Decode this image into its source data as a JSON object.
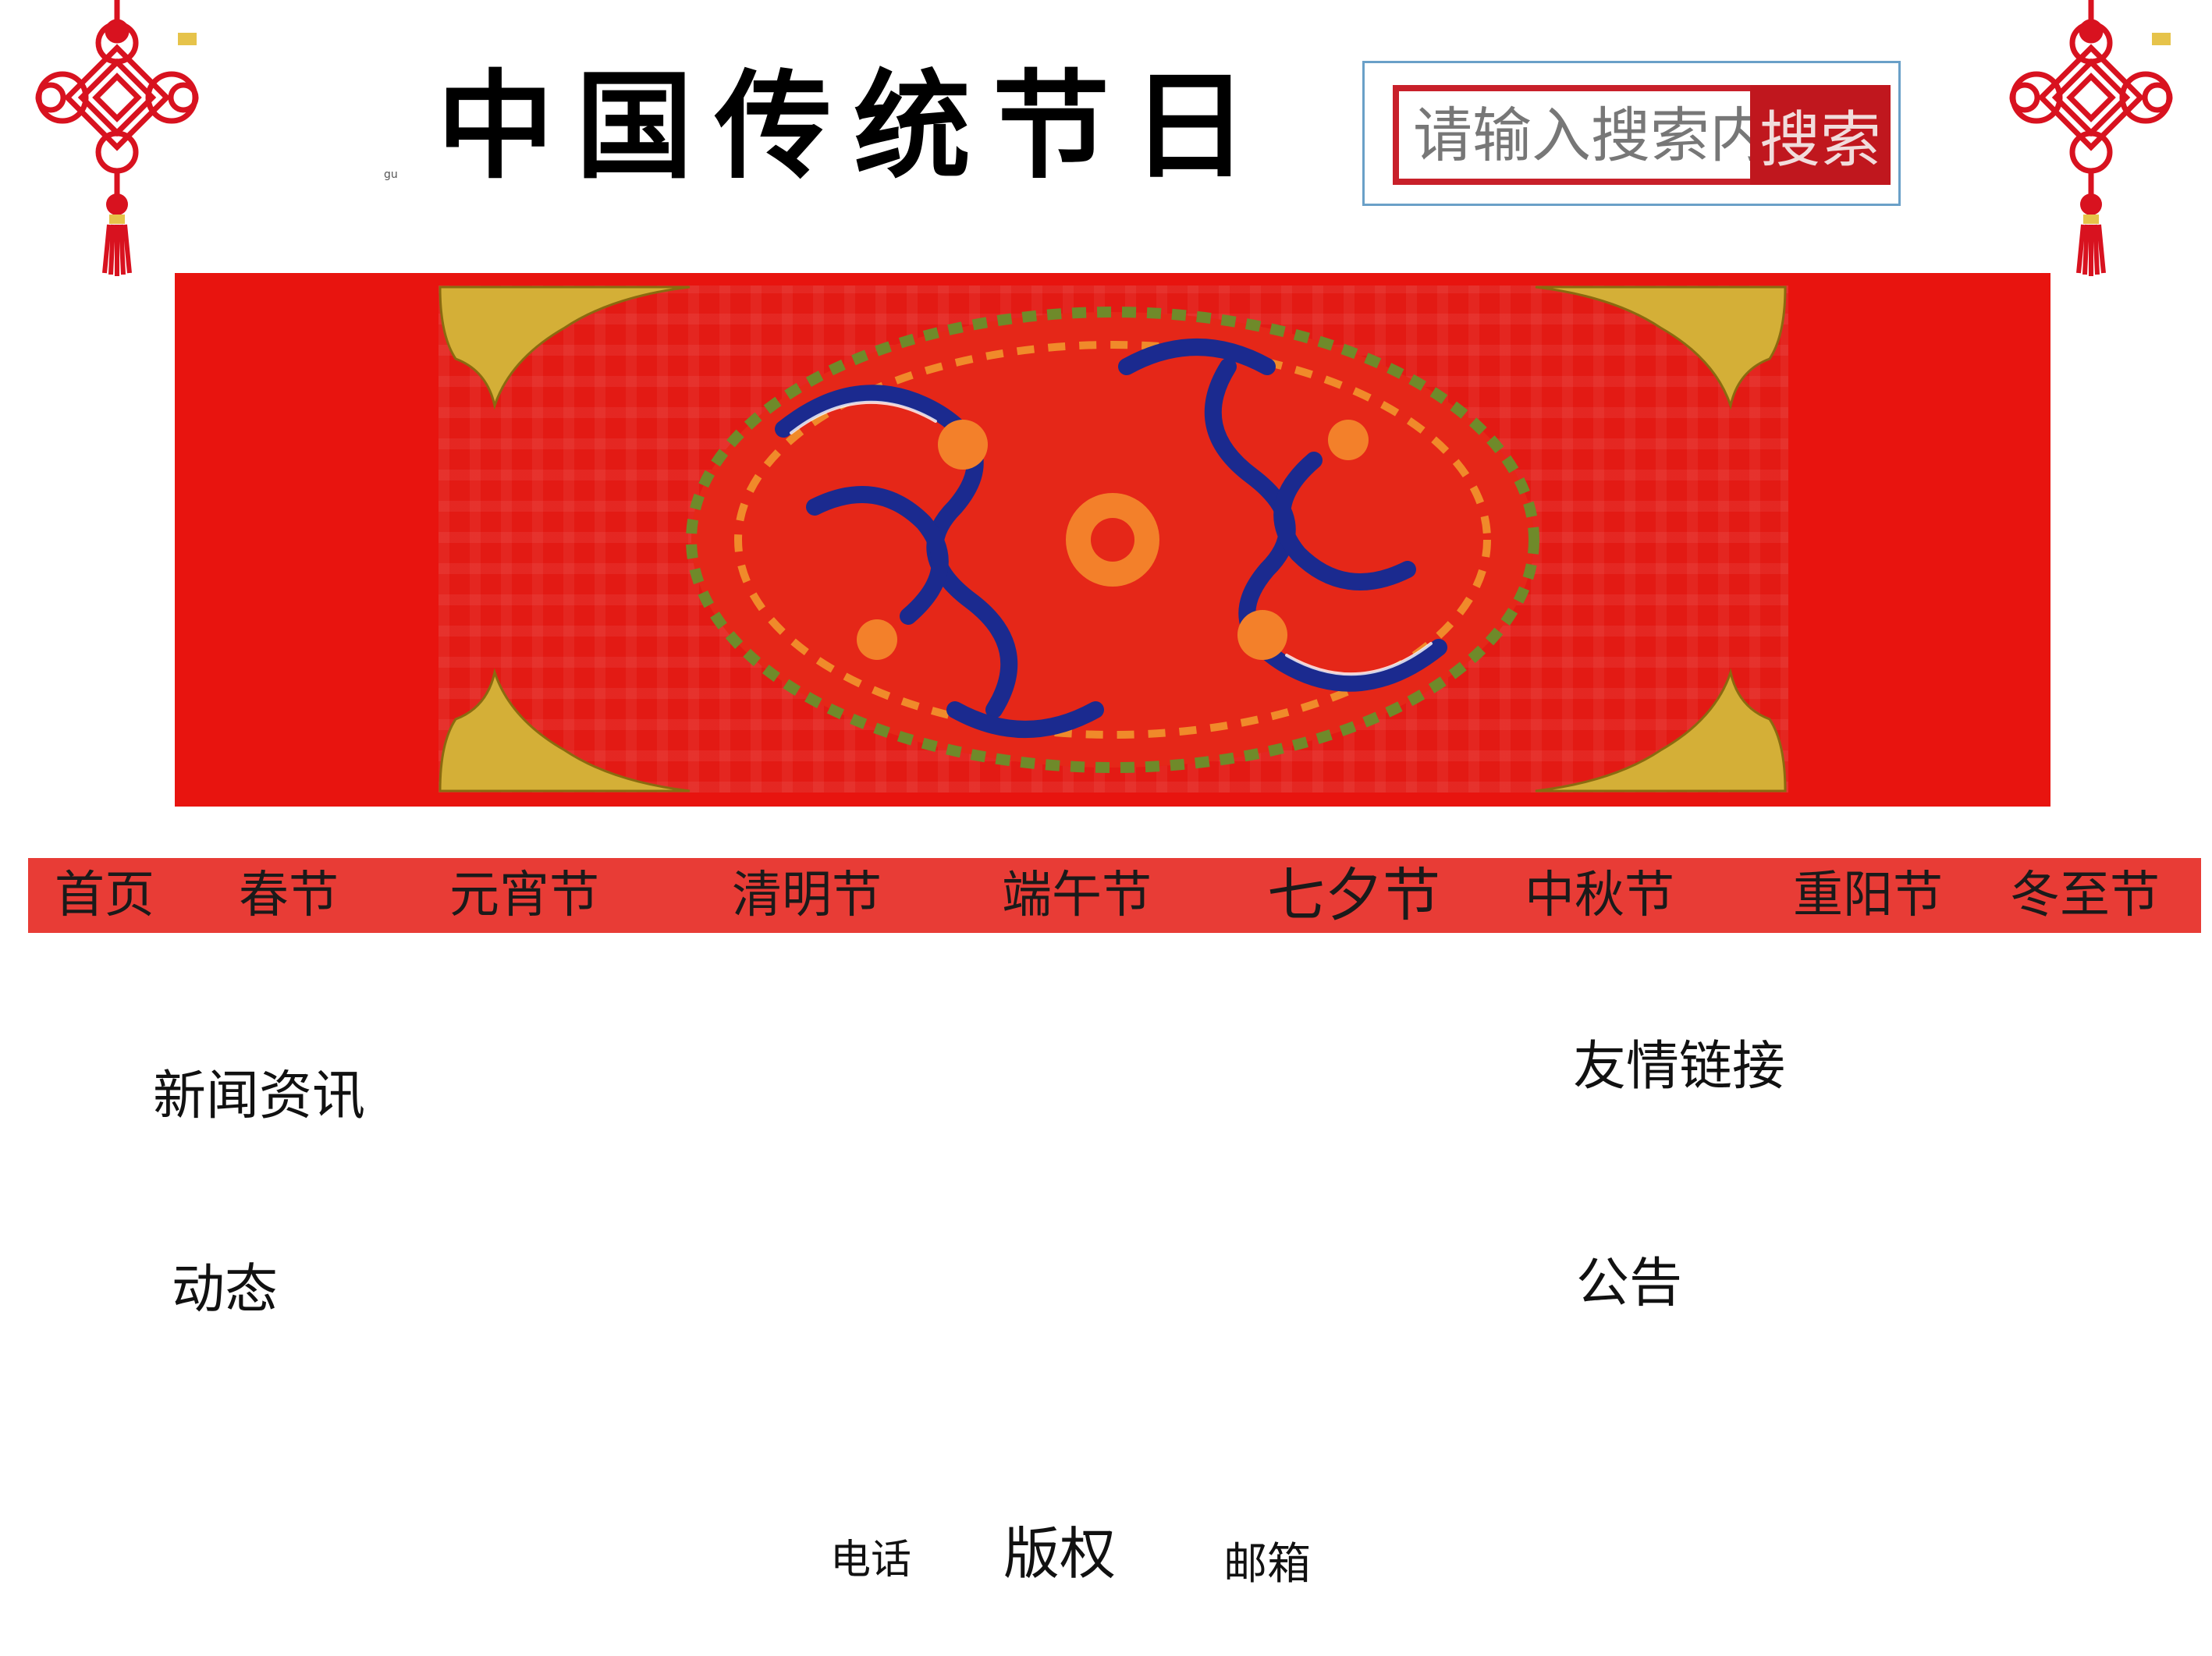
{
  "header": {
    "tiny_mark": "gu",
    "title": "中国传统节日"
  },
  "search": {
    "placeholder": "请输入搜索内容",
    "button_label": "搜索"
  },
  "nav": {
    "items": [
      {
        "label": "首页"
      },
      {
        "label": "春节"
      },
      {
        "label": "元宵节"
      },
      {
        "label": "清明节"
      },
      {
        "label": "端午节"
      },
      {
        "label": "七夕节"
      },
      {
        "label": "中秋节"
      },
      {
        "label": "重阳节"
      },
      {
        "label": "冬至节"
      }
    ]
  },
  "sections": {
    "news": "新闻资讯",
    "friendly_links": "友情链接",
    "dynamics": "动态",
    "announcements": "公告"
  },
  "footer": {
    "phone": "电话",
    "copyright": "版权",
    "email": "邮箱"
  },
  "colors": {
    "banner_red": "#e8140f",
    "nav_red": "#e83c36",
    "search_button": "#c0171e",
    "knot_red": "#d8121f",
    "ornament_gold": "#d4af37",
    "medallion_blue": "#1b2a8f"
  },
  "icons": {
    "left_ornament": "chinese-knot-icon",
    "right_ornament": "chinese-knot-icon",
    "banner_center": "dragon-phoenix-medallion"
  }
}
